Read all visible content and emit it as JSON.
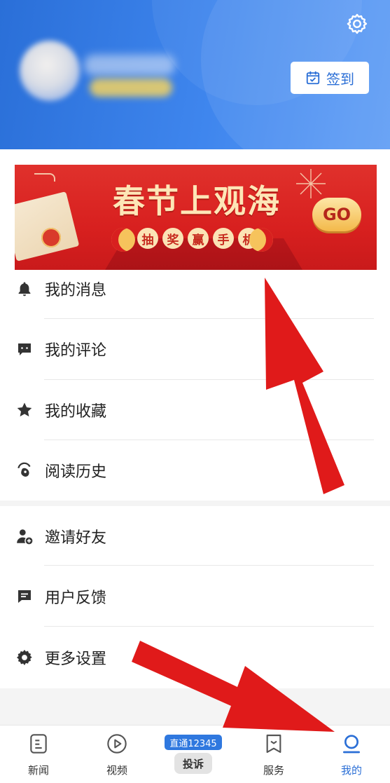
{
  "header": {
    "checkin_label": "签到",
    "icons": {
      "settings": "gear-icon",
      "checkin": "calendar-check-icon"
    },
    "gradient": [
      "#2a6fd8",
      "#5f9df5"
    ]
  },
  "banner": {
    "title": "春节上观海",
    "subtitle_chars": [
      "抽",
      "奖",
      "赢",
      "手",
      "机"
    ],
    "go_label": "GO",
    "background_color": "#d8201f"
  },
  "menu": {
    "items": [
      {
        "label": "我的消息",
        "icon": "bell-icon"
      },
      {
        "label": "我的评论",
        "icon": "comment-icon"
      },
      {
        "label": "我的收藏",
        "icon": "star-icon"
      },
      {
        "label": "阅读历史",
        "icon": "history-icon"
      },
      {
        "label": "邀请好友",
        "icon": "add-friend-icon"
      },
      {
        "label": "用户反馈",
        "icon": "feedback-icon"
      },
      {
        "label": "更多设置",
        "icon": "settings-gear-icon"
      }
    ]
  },
  "tabbar": {
    "tabs": [
      {
        "label": "新闻",
        "icon": "news-icon",
        "active": false
      },
      {
        "label": "视频",
        "icon": "play-icon",
        "active": false
      },
      {
        "label": "服务",
        "icon": "service-icon",
        "active": false
      },
      {
        "label": "我的",
        "icon": "profile-icon",
        "active": true
      }
    ],
    "complaint": {
      "top_label": "直通12345",
      "bottom_label": "投诉"
    },
    "active_color": "#2b6fd6"
  },
  "annotation_color": "#e01a1a"
}
